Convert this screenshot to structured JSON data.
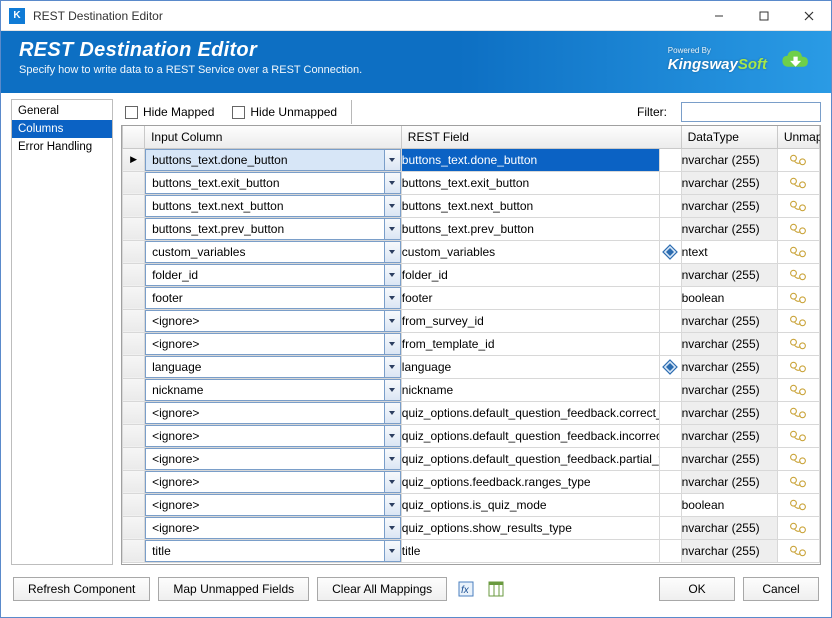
{
  "window": {
    "title": "REST Destination Editor"
  },
  "banner": {
    "heading": "REST Destination Editor",
    "subtitle": "Specify how to write data to a REST Service over a REST Connection.",
    "powered_by": "Powered By",
    "brand_pre": "Kingsway",
    "brand_post": "Soft"
  },
  "nav": {
    "items": [
      "General",
      "Columns",
      "Error Handling"
    ],
    "selected_index": 1
  },
  "options": {
    "hide_mapped_label": "Hide Mapped",
    "hide_unmapped_label": "Hide Unmapped",
    "filter_label": "Filter:",
    "filter_value": ""
  },
  "columns": {
    "input": "Input Column",
    "rest": "REST Field",
    "datatype": "DataType",
    "unmap": "Unmap"
  },
  "rows": [
    {
      "input": "buttons_text.done_button",
      "rest": "buttons_text.done_button",
      "type": "nvarchar (255)",
      "type_plain": false,
      "icon": false,
      "selected": true
    },
    {
      "input": "buttons_text.exit_button",
      "rest": "buttons_text.exit_button",
      "type": "nvarchar (255)",
      "type_plain": false,
      "icon": false,
      "selected": false
    },
    {
      "input": "buttons_text.next_button",
      "rest": "buttons_text.next_button",
      "type": "nvarchar (255)",
      "type_plain": false,
      "icon": false,
      "selected": false
    },
    {
      "input": "buttons_text.prev_button",
      "rest": "buttons_text.prev_button",
      "type": "nvarchar (255)",
      "type_plain": false,
      "icon": false,
      "selected": false
    },
    {
      "input": "custom_variables",
      "rest": "custom_variables",
      "type": "ntext",
      "type_plain": true,
      "icon": true,
      "selected": false
    },
    {
      "input": "folder_id",
      "rest": "folder_id",
      "type": "nvarchar (255)",
      "type_plain": false,
      "icon": false,
      "selected": false
    },
    {
      "input": "footer",
      "rest": "footer",
      "type": "boolean",
      "type_plain": true,
      "icon": false,
      "selected": false
    },
    {
      "input": "<ignore>",
      "rest": "from_survey_id",
      "type": "nvarchar (255)",
      "type_plain": false,
      "icon": false,
      "selected": false
    },
    {
      "input": "<ignore>",
      "rest": "from_template_id",
      "type": "nvarchar (255)",
      "type_plain": false,
      "icon": false,
      "selected": false
    },
    {
      "input": "language",
      "rest": "language",
      "type": "nvarchar (255)",
      "type_plain": false,
      "icon": true,
      "selected": false
    },
    {
      "input": "nickname",
      "rest": "nickname",
      "type": "nvarchar (255)",
      "type_plain": false,
      "icon": false,
      "selected": false
    },
    {
      "input": "<ignore>",
      "rest": "quiz_options.default_question_feedback.correct_text",
      "type": "nvarchar (255)",
      "type_plain": false,
      "icon": false,
      "selected": false
    },
    {
      "input": "<ignore>",
      "rest": "quiz_options.default_question_feedback.incorrect_t...",
      "type": "nvarchar (255)",
      "type_plain": false,
      "icon": false,
      "selected": false
    },
    {
      "input": "<ignore>",
      "rest": "quiz_options.default_question_feedback.partial_text",
      "type": "nvarchar (255)",
      "type_plain": false,
      "icon": false,
      "selected": false
    },
    {
      "input": "<ignore>",
      "rest": "quiz_options.feedback.ranges_type",
      "type": "nvarchar (255)",
      "type_plain": false,
      "icon": false,
      "selected": false
    },
    {
      "input": "<ignore>",
      "rest": "quiz_options.is_quiz_mode",
      "type": "boolean",
      "type_plain": true,
      "icon": false,
      "selected": false
    },
    {
      "input": "<ignore>",
      "rest": "quiz_options.show_results_type",
      "type": "nvarchar (255)",
      "type_plain": false,
      "icon": false,
      "selected": false
    },
    {
      "input": "title",
      "rest": "title",
      "type": "nvarchar (255)",
      "type_plain": false,
      "icon": false,
      "selected": false
    }
  ],
  "buttons": {
    "refresh": "Refresh Component",
    "map_unmapped": "Map Unmapped Fields",
    "clear": "Clear All Mappings",
    "ok": "OK",
    "cancel": "Cancel"
  }
}
